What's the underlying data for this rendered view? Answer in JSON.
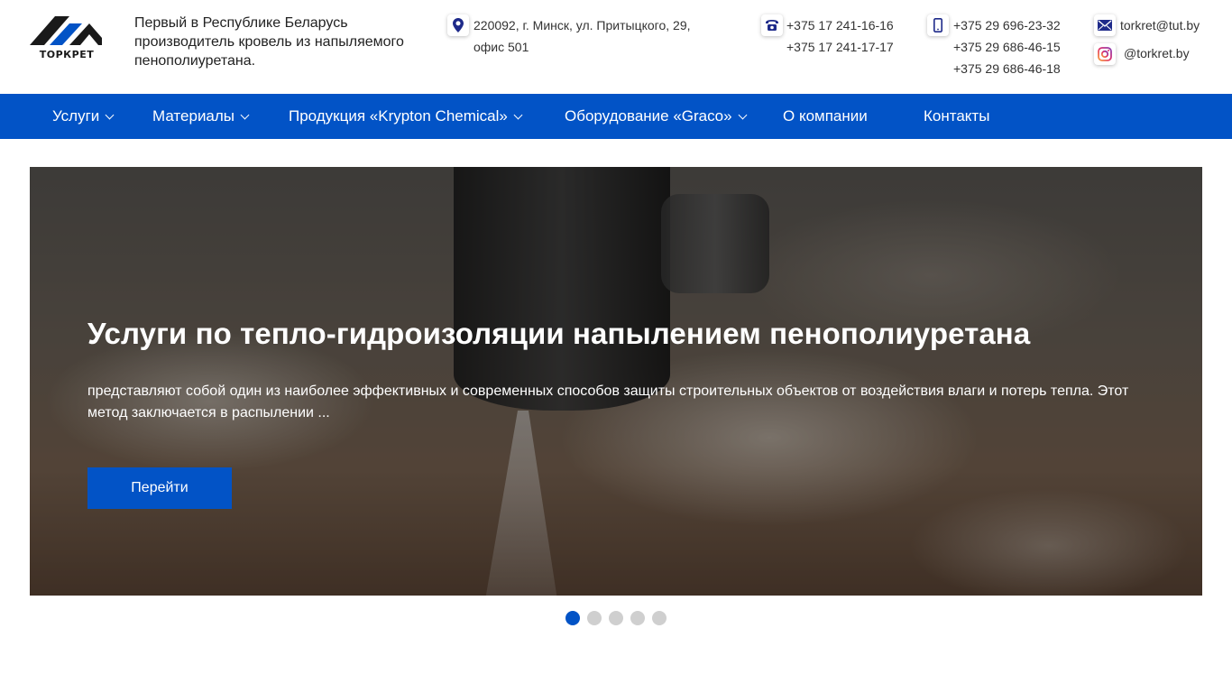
{
  "header": {
    "logo_text": "ТОРКРЕТ",
    "tagline": "Первый в Республике Беларусь производитель кровель из напыляемого пенополиуретана.",
    "address": {
      "line1": "220092, г. Минск, ул. Притыцкого, 29,",
      "line2": "офис 501"
    },
    "phones_landline": [
      "+375 17 241-16-16",
      "+375 17 241-17-17"
    ],
    "phones_mobile": [
      "+375 29 696-23-32",
      "+375 29 686-46-15",
      "+375 29 686-46-18"
    ],
    "email": "torkret@tut.by",
    "instagram": "@torkret.by"
  },
  "nav": {
    "items": [
      {
        "label": "Услуги",
        "dropdown": true
      },
      {
        "label": "Материалы",
        "dropdown": true
      },
      {
        "label": "Продукция «Krypton Chemical»",
        "dropdown": true
      },
      {
        "label": "Оборудование «Graco»",
        "dropdown": true
      },
      {
        "label": "О компании",
        "dropdown": false
      },
      {
        "label": "Контакты",
        "dropdown": false
      }
    ]
  },
  "hero": {
    "title": "Услуги по тепло-гидроизоляции напылением пенополиуретана",
    "description": "представляют собой один из наиболее эффективных и современных способов защиты строительных объектов от воздействия влаги и потерь тепла. Этот метод заключается в распылении ...",
    "button_label": "Перейти"
  },
  "slider": {
    "total": 5,
    "active": 1
  },
  "colors": {
    "brand_blue": "#0253c6",
    "dot_inactive": "#cfcfcf"
  }
}
